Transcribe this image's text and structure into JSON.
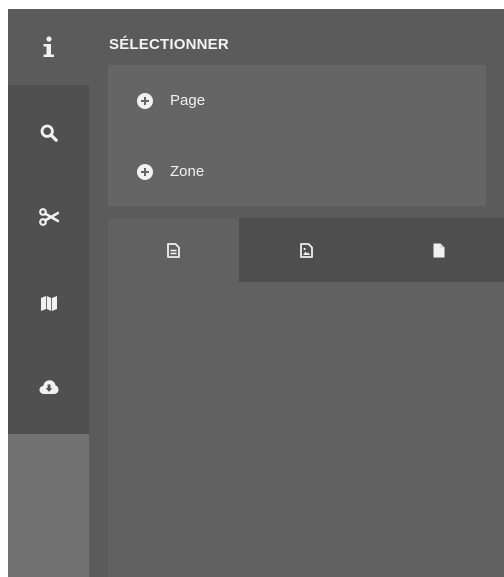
{
  "toolbar": {
    "items": [
      {
        "name": "info",
        "icon": "info-icon",
        "active": true
      },
      {
        "name": "search",
        "icon": "search-icon",
        "active": false
      },
      {
        "name": "cut",
        "icon": "scissors-icon",
        "active": false
      },
      {
        "name": "map",
        "icon": "map-icon",
        "active": false
      },
      {
        "name": "download",
        "icon": "cloud-download-icon",
        "active": false
      }
    ]
  },
  "panel": {
    "section_title": "SÉLECTIONNER",
    "select_items": [
      {
        "label": "Page",
        "icon": "plus-circle-icon"
      },
      {
        "label": "Zone",
        "icon": "plus-circle-icon"
      }
    ],
    "tabs": [
      {
        "icon": "file-text-icon",
        "active": true
      },
      {
        "icon": "file-image-icon",
        "active": false
      },
      {
        "icon": "file-icon",
        "active": false
      }
    ]
  },
  "colors": {
    "toolbar_bg": "#505050",
    "panel_bg": "#5b5b5b",
    "box_bg": "#656565",
    "tab_bg": "#4e4e4e",
    "tab_active_bg": "#616161",
    "text": "#f1f1f1"
  }
}
